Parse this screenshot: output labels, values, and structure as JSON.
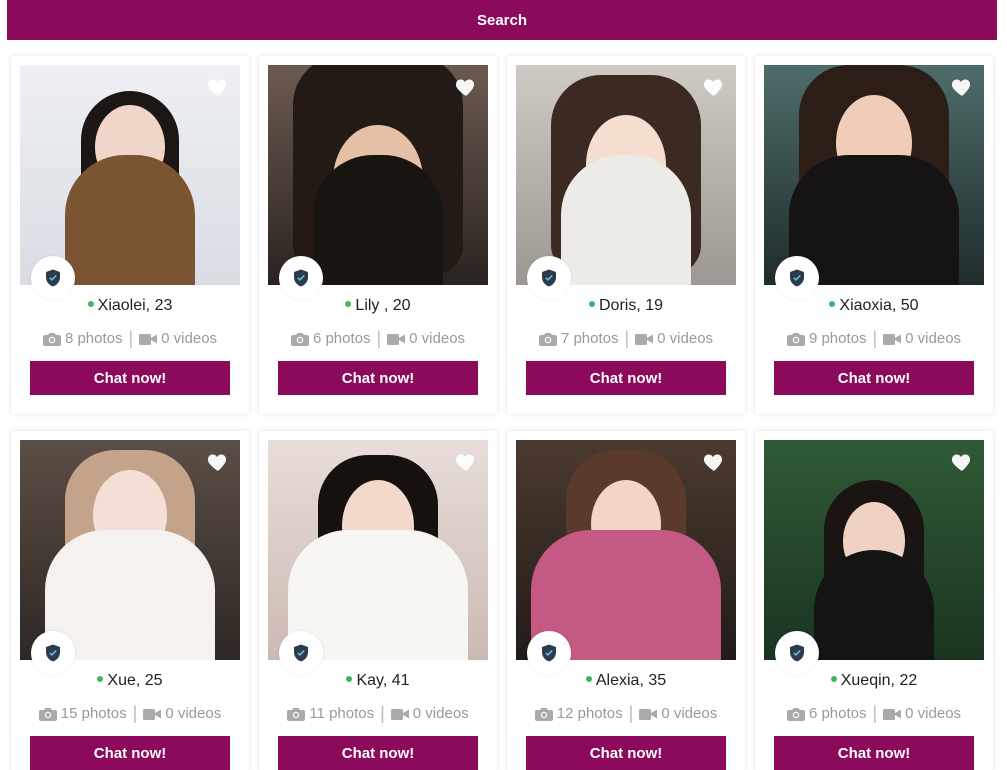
{
  "search": {
    "label": "Search"
  },
  "colors": {
    "accent": "#8b0a5b",
    "online": "#3fb65b"
  },
  "profiles": [
    {
      "name": "Xiaolei, 23",
      "photos": "8 photos",
      "videos": "0 videos",
      "cta": "Chat now!"
    },
    {
      "name": "Lily , 20",
      "photos": "6 photos",
      "videos": "0 videos",
      "cta": "Chat now!"
    },
    {
      "name": "Doris, 19",
      "photos": "7 photos",
      "videos": "0 videos",
      "cta": "Chat now!"
    },
    {
      "name": "Xiaoxia, 50",
      "photos": "9 photos",
      "videos": "0 videos",
      "cta": "Chat now!"
    },
    {
      "name": "Xue, 25",
      "photos": "15 photos",
      "videos": "0 videos",
      "cta": "Chat now!"
    },
    {
      "name": "Kay, 41",
      "photos": "11 photos",
      "videos": "0 videos",
      "cta": "Chat now!"
    },
    {
      "name": "Alexia, 35",
      "photos": "12 photos",
      "videos": "0 videos",
      "cta": "Chat now!"
    },
    {
      "name": "Xueqin, 22",
      "photos": "6 photos",
      "videos": "0 videos",
      "cta": "Chat now!"
    }
  ],
  "icons": {
    "favorite": "heart-icon",
    "verified": "shield-icon",
    "photos": "camera-icon",
    "videos": "video-camera-icon"
  }
}
